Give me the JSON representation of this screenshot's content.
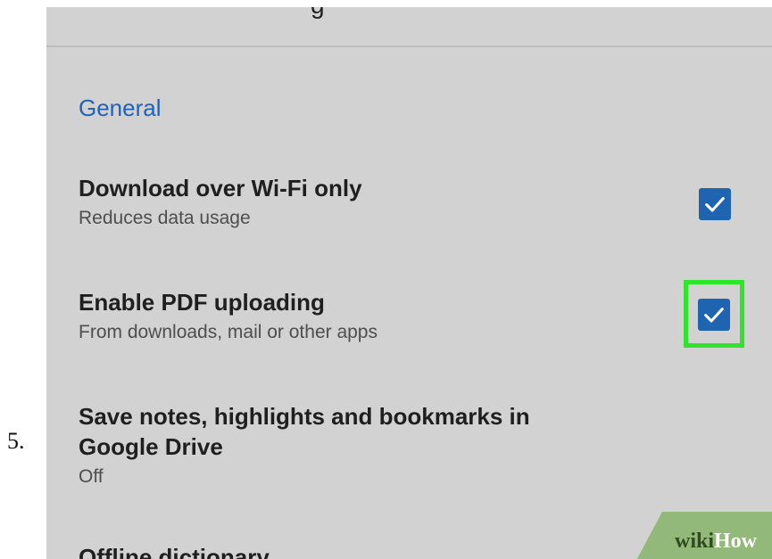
{
  "step_number": "5.",
  "topbar": {
    "title_fragment": "g"
  },
  "section": {
    "header": "General"
  },
  "settings": [
    {
      "title": "Download over Wi-Fi only",
      "subtitle": "Reduces data usage",
      "checked": true
    },
    {
      "title": "Enable PDF uploading",
      "subtitle": "From downloads, mail or other apps",
      "checked": true,
      "highlighted": true
    },
    {
      "title_line1": "Save notes, highlights and bookmarks in",
      "title_line2": "Google Drive",
      "subtitle": "Off"
    },
    {
      "title": "Offline dictionary"
    }
  ],
  "watermark": {
    "wiki": "wiki",
    "how": "How"
  },
  "colors": {
    "screen_bg": "#d2d2d2",
    "accent_blue": "#1e63b8",
    "checkbox_blue": "#1f64b0",
    "highlight_green": "#2ee52b",
    "watermark_green": "#93b97a"
  },
  "icons": {
    "checkbox": "check-icon"
  }
}
